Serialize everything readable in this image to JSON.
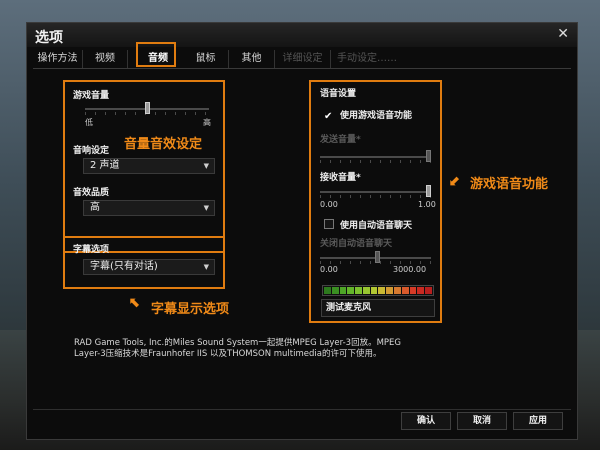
{
  "dialog": {
    "title": "选项"
  },
  "tabs": [
    {
      "label": "操作方法",
      "state": "normal"
    },
    {
      "label": "视频",
      "state": "normal"
    },
    {
      "label": "音频",
      "state": "active"
    },
    {
      "label": "鼠标",
      "state": "normal"
    },
    {
      "label": "其他",
      "state": "normal"
    },
    {
      "label": "详细设定",
      "state": "disabled"
    },
    {
      "label": "手动设定……",
      "state": "disabled"
    }
  ],
  "audio": {
    "game_volume": {
      "label": "游戏音量",
      "low": "低",
      "high": "高",
      "value": 0.5
    },
    "sound_setting": {
      "label": "音响设定",
      "value": "2 声道"
    },
    "sound_quality": {
      "label": "音效品质",
      "value": "高"
    },
    "callout": "音量音效设定"
  },
  "subtitles": {
    "label": "字幕选项",
    "value": "字幕(只有对话)",
    "callout": "字幕显示选项"
  },
  "voice": {
    "title": "语音设置",
    "use_voice": {
      "label": "使用游戏语音功能",
      "checked": true
    },
    "send_volume": {
      "label": "发送音量*",
      "value": 1.0
    },
    "receive_volume": {
      "label": "接收音量*",
      "min": "0.00",
      "max": "1.00",
      "value": 1.0
    },
    "auto_voice": {
      "label": "使用自动语音聊天",
      "checked": false
    },
    "auto_close": {
      "label": "关闭自动语音聊天",
      "min": "0.00",
      "max": "3000.00",
      "value": 0.52
    },
    "test_mic_label": "测试麦克风",
    "callout": "游戏语音功能",
    "meter_colors": [
      "#2d7a1e",
      "#3a8f22",
      "#4ea627",
      "#63b52b",
      "#7cc02f",
      "#98c631",
      "#b2c733",
      "#c9b934",
      "#d29a33",
      "#d67a30",
      "#d95a2c",
      "#d63b27",
      "#c92a22",
      "#b81f1e"
    ]
  },
  "info": {
    "text": "RAD Game Tools, Inc.的Miles Sound System一起提供MPEG Layer-3回放。MPEG Layer-3压缩技术是Fraunhofer IIS 以及THOMSON multimedia的许可下使用。"
  },
  "buttons": {
    "ok": "确认",
    "cancel": "取消",
    "apply": "应用"
  },
  "colors": {
    "accent": "#e07c10"
  }
}
